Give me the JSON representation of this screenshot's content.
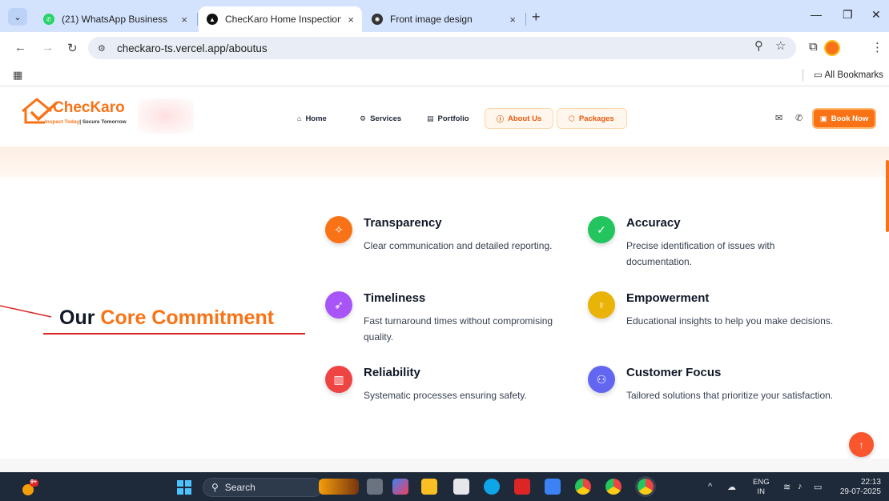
{
  "browser": {
    "tabs": [
      {
        "title": "(21) WhatsApp Business",
        "close": "×"
      },
      {
        "title": "ChecKaro Home Inspection - In",
        "close": "×"
      },
      {
        "title": "Front image design",
        "close": "×"
      }
    ],
    "new_tab": "+",
    "url": "checkaro-ts.vercel.app/aboutus",
    "bookmarks_label": "All Bookmarks"
  },
  "site": {
    "logo_name": "ChecKaro",
    "logo_tag_a": "Inspect Today",
    "logo_tag_b": "| Secure Tomorrow",
    "nav": {
      "home": "Home",
      "services": "Services",
      "portfolio": "Portfolio",
      "about": "About Us",
      "packages": "Packages"
    },
    "book_now": "Book Now"
  },
  "main": {
    "heading_a": "Our",
    "heading_b": "Core Commitment",
    "features": [
      {
        "title": "Transparency",
        "desc": "Clear communication and detailed reporting.",
        "color": "#f97316"
      },
      {
        "title": "Accuracy",
        "desc": "Precise identification of issues with documentation.",
        "color": "#22c55e"
      },
      {
        "title": "Timeliness",
        "desc": "Fast turnaround times without compromising quality.",
        "color": "#a855f7"
      },
      {
        "title": "Empowerment",
        "desc": "Educational insights to help you make decisions.",
        "color": "#eab308"
      },
      {
        "title": "Reliability",
        "desc": "Systematic processes ensuring safety.",
        "color": "#ef4444"
      },
      {
        "title": "Customer Focus",
        "desc": "Tailored solutions that prioritize your satisfaction.",
        "color": "#6366f1"
      }
    ]
  },
  "taskbar": {
    "badge": "9+",
    "search": "Search",
    "lang_a": "ENG",
    "lang_b": "IN",
    "time": "22:13",
    "date": "29-07-2025"
  },
  "colors": {
    "brand": "#f97316",
    "underline": "#dc2626"
  }
}
